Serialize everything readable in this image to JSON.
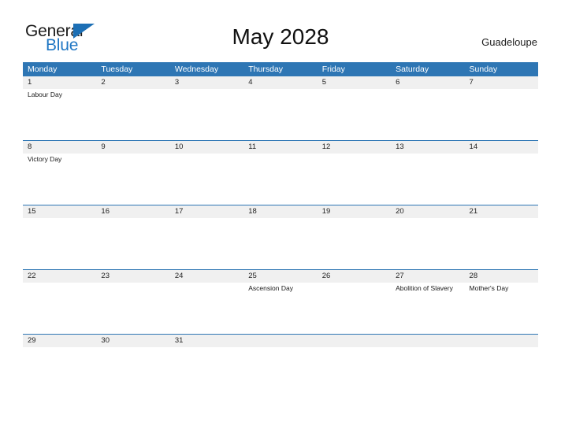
{
  "brand": {
    "name_part1": "General",
    "name_part2": "Blue",
    "accent_color": "#2077c4",
    "triangle_color": "#1c6fb5",
    "triangle_icon": "triangle-flag-icon"
  },
  "header": {
    "title": "May 2028",
    "region": "Guadeloupe"
  },
  "calendar": {
    "month": "May",
    "year": "2028",
    "header_bg_color": "#2e76b4",
    "date_band_color": "#f0f0f0",
    "weekdays": [
      "Monday",
      "Tuesday",
      "Wednesday",
      "Thursday",
      "Friday",
      "Saturday",
      "Sunday"
    ],
    "weeks": [
      {
        "days": [
          {
            "date": "1",
            "event": "Labour Day"
          },
          {
            "date": "2",
            "event": ""
          },
          {
            "date": "3",
            "event": ""
          },
          {
            "date": "4",
            "event": ""
          },
          {
            "date": "5",
            "event": ""
          },
          {
            "date": "6",
            "event": ""
          },
          {
            "date": "7",
            "event": ""
          }
        ]
      },
      {
        "days": [
          {
            "date": "8",
            "event": "Victory Day"
          },
          {
            "date": "9",
            "event": ""
          },
          {
            "date": "10",
            "event": ""
          },
          {
            "date": "11",
            "event": ""
          },
          {
            "date": "12",
            "event": ""
          },
          {
            "date": "13",
            "event": ""
          },
          {
            "date": "14",
            "event": ""
          }
        ]
      },
      {
        "days": [
          {
            "date": "15",
            "event": ""
          },
          {
            "date": "16",
            "event": ""
          },
          {
            "date": "17",
            "event": ""
          },
          {
            "date": "18",
            "event": ""
          },
          {
            "date": "19",
            "event": ""
          },
          {
            "date": "20",
            "event": ""
          },
          {
            "date": "21",
            "event": ""
          }
        ]
      },
      {
        "days": [
          {
            "date": "22",
            "event": ""
          },
          {
            "date": "23",
            "event": ""
          },
          {
            "date": "24",
            "event": ""
          },
          {
            "date": "25",
            "event": "Ascension Day"
          },
          {
            "date": "26",
            "event": ""
          },
          {
            "date": "27",
            "event": "Abolition of Slavery"
          },
          {
            "date": "28",
            "event": "Mother's Day"
          }
        ]
      },
      {
        "days": [
          {
            "date": "29",
            "event": ""
          },
          {
            "date": "30",
            "event": ""
          },
          {
            "date": "31",
            "event": ""
          },
          {
            "date": "",
            "event": ""
          },
          {
            "date": "",
            "event": ""
          },
          {
            "date": "",
            "event": ""
          },
          {
            "date": "",
            "event": ""
          }
        ]
      }
    ]
  }
}
